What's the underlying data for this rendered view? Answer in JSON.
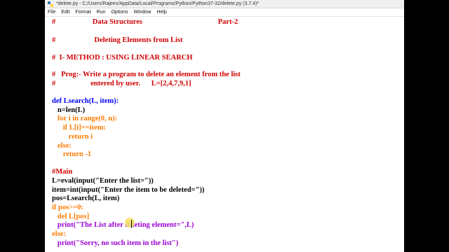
{
  "window": {
    "title": "*delete.py - C:/Users/Rajeev/AppData/Local/Programs/Python/Python37-32/delete.py (3.7.4)*"
  },
  "menu": [
    "File",
    "Edit",
    "Format",
    "Run",
    "Options",
    "Window",
    "Help"
  ],
  "code_lines": [
    {
      "text": "#                    Data Structures                                         Part-2"
    },
    {
      "text": "#                     Deleting Elements from List"
    },
    {
      "text": "#  I- METHOD : USING LINEAR SEARCH"
    },
    {
      "text": "#   Prog:- Write a program to delete an element from the list"
    },
    {
      "text": "#                   entered by user.      L=[2,4,7,9,1]"
    },
    {
      "text": "def Lsearch(L, item):"
    },
    {
      "text": "   n=len(L)"
    },
    {
      "text": "   for i in range(0, n):"
    },
    {
      "text": "      if L[i]==item:"
    },
    {
      "text": "         return i"
    },
    {
      "text": "   else:"
    },
    {
      "text": "      return -1"
    },
    {
      "text": "#Main"
    },
    {
      "text": "L=eval(input(\"Enter the list=\"))"
    },
    {
      "text": "item=int(input(\"Enter the item to be deleted=\"))"
    },
    {
      "text": "pos=Lsearch(L, item)"
    },
    {
      "text": "if pos>=0:"
    },
    {
      "text": "   del L[pos]"
    },
    {
      "text": "   print(\"The List after deleting element=\",L)"
    },
    {
      "text": "else:"
    },
    {
      "text": "   print(\"Sorry, no such item in the list\")"
    }
  ],
  "colors": {
    "comment": "#d00000",
    "keyword": "#ff7a00",
    "string": "#007a00",
    "builtin": "#9b00d3",
    "definition": "#0000ff"
  }
}
